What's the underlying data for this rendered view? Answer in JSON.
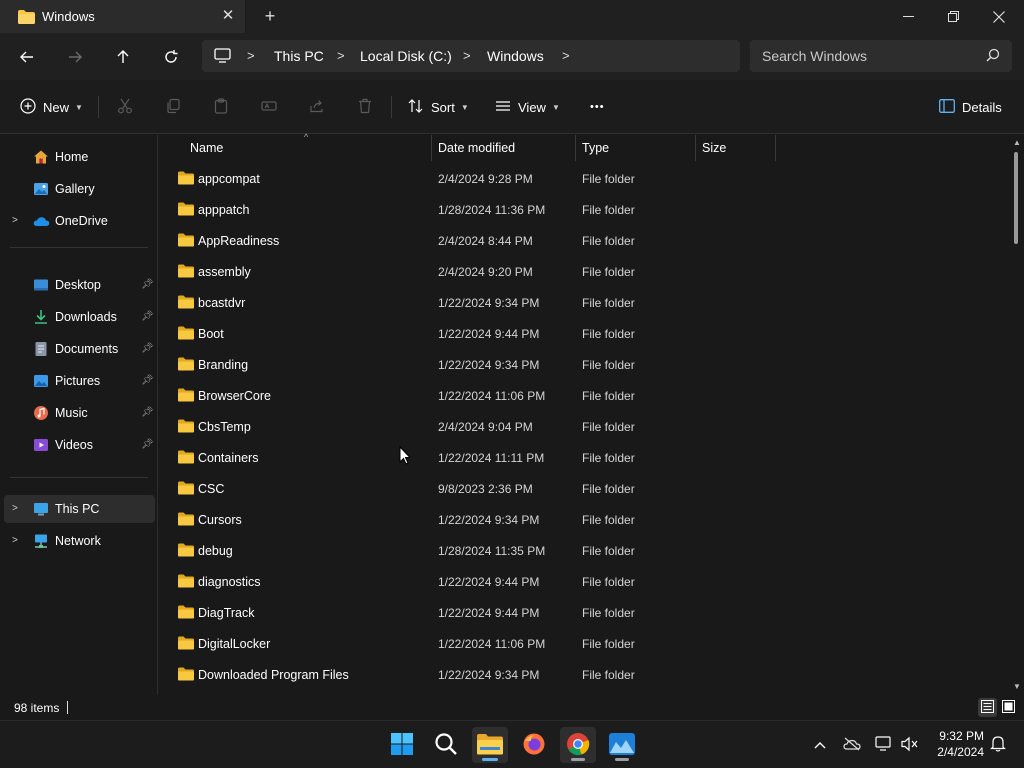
{
  "window": {
    "tab_title": "Windows"
  },
  "address": {
    "crumbs": [
      "This PC",
      "Local Disk (C:)",
      "Windows"
    ],
    "search_placeholder": "Search Windows"
  },
  "commandbar": {
    "new_label": "New",
    "sort_label": "Sort",
    "view_label": "View",
    "more_label": "•••",
    "details_label": "Details"
  },
  "nav": {
    "home": "Home",
    "gallery": "Gallery",
    "onedrive": "OneDrive",
    "desktop": "Desktop",
    "downloads": "Downloads",
    "documents": "Documents",
    "pictures": "Pictures",
    "music": "Music",
    "videos": "Videos",
    "thispc": "This PC",
    "network": "Network"
  },
  "columns": {
    "name": "Name",
    "date": "Date modified",
    "type": "Type",
    "size": "Size"
  },
  "files": [
    {
      "name": "appcompat",
      "date": "2/4/2024 9:28 PM",
      "type": "File folder"
    },
    {
      "name": "apppatch",
      "date": "1/28/2024 11:36 PM",
      "type": "File folder"
    },
    {
      "name": "AppReadiness",
      "date": "2/4/2024 8:44 PM",
      "type": "File folder"
    },
    {
      "name": "assembly",
      "date": "2/4/2024 9:20 PM",
      "type": "File folder"
    },
    {
      "name": "bcastdvr",
      "date": "1/22/2024 9:34 PM",
      "type": "File folder"
    },
    {
      "name": "Boot",
      "date": "1/22/2024 9:44 PM",
      "type": "File folder"
    },
    {
      "name": "Branding",
      "date": "1/22/2024 9:34 PM",
      "type": "File folder"
    },
    {
      "name": "BrowserCore",
      "date": "1/22/2024 11:06 PM",
      "type": "File folder"
    },
    {
      "name": "CbsTemp",
      "date": "2/4/2024 9:04 PM",
      "type": "File folder"
    },
    {
      "name": "Containers",
      "date": "1/22/2024 11:11 PM",
      "type": "File folder"
    },
    {
      "name": "CSC",
      "date": "9/8/2023 2:36 PM",
      "type": "File folder"
    },
    {
      "name": "Cursors",
      "date": "1/22/2024 9:34 PM",
      "type": "File folder"
    },
    {
      "name": "debug",
      "date": "1/28/2024 11:35 PM",
      "type": "File folder"
    },
    {
      "name": "diagnostics",
      "date": "1/22/2024 9:44 PM",
      "type": "File folder"
    },
    {
      "name": "DiagTrack",
      "date": "1/22/2024 9:44 PM",
      "type": "File folder"
    },
    {
      "name": "DigitalLocker",
      "date": "1/22/2024 11:06 PM",
      "type": "File folder"
    },
    {
      "name": "Downloaded Program Files",
      "date": "1/22/2024 9:34 PM",
      "type": "File folder"
    }
  ],
  "status": {
    "item_count": "98 items"
  },
  "clock": {
    "time": "9:32 PM",
    "date": "2/4/2024"
  },
  "colors": {
    "folder": "#f8c842",
    "folder_dark": "#e0a91f",
    "accent": "#5fb2f2"
  }
}
